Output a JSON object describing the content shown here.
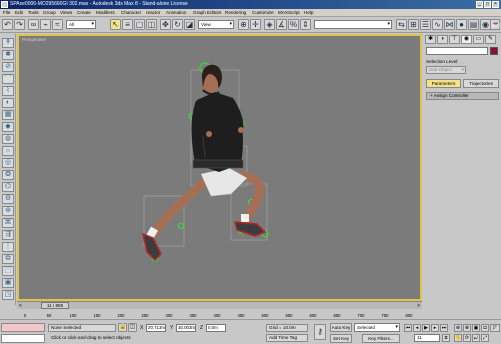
{
  "titlebar": {
    "title": "SPAxe0006-MO295660GI 302.max - Autodesk 3ds Max 8 - Stand-alone License",
    "min": "_",
    "max": "□",
    "close": "×"
  },
  "menu": [
    "File",
    "Edit",
    "Tools",
    "Group",
    "Views",
    "Create",
    "Modifiers",
    "Character",
    "reactor",
    "Animation",
    "Graph Editors",
    "Rendering",
    "Customize",
    "MAXScript",
    "Help"
  ],
  "toolbar": {
    "selection_filter": "All",
    "ref_coord": "View",
    "named_selection": "",
    "icons": [
      "undo-icon",
      "redo-icon",
      "link-icon",
      "unlink-icon",
      "bind-icon",
      "select-icon",
      "select-by-name-icon",
      "region-select-icon",
      "window-crossing-icon",
      "move-icon",
      "rotate-icon",
      "scale-icon",
      "pivot-icon",
      "manipulate-icon",
      "snap-icon",
      "angle-snap-icon",
      "percent-snap-icon",
      "spinner-snap-icon",
      "mirror-icon",
      "align-icon",
      "layer-icon",
      "curve-editor-icon",
      "schematic-icon",
      "material-editor-icon",
      "render-setup-icon",
      "render-icon",
      "quick-render-icon"
    ]
  },
  "viewport": {
    "label": "Perspective"
  },
  "command_panel": {
    "tab_icons": [
      "create-tab-icon",
      "modify-tab-icon",
      "hierarchy-tab-icon",
      "motion-tab-icon",
      "display-tab-icon",
      "utilities-tab-icon"
    ],
    "selection_level_label": "Selection Level:",
    "sub_object": "Sub-Object",
    "parameters_label": "Parameters",
    "trajectories_label": "Trajectories",
    "rollout_label": "Assign Controller",
    "colors": {
      "swatch": "#8a1038",
      "active_button": "#f2e38a"
    }
  },
  "time_slider": {
    "label": "11 / 895",
    "left": "<",
    "right": ">"
  },
  "trackbar": {
    "ticks": [
      "0",
      "50",
      "100",
      "150",
      "200",
      "250",
      "300",
      "350",
      "400",
      "450",
      "500",
      "550",
      "600",
      "650",
      "700",
      "750",
      "800"
    ]
  },
  "status": {
    "selected": "None Selected",
    "prompt": "Click or click-and-drag to select objects",
    "x_label": "X",
    "x_value": "20.713m",
    "y_label": "Y",
    "y_value": "30.003m",
    "z_label": "Z",
    "z_value": "0.0m",
    "grid": "Grid = 10.0m",
    "add_time_tag": "Add Time Tag",
    "auto_key": "Auto Key",
    "set_key": "Set Key",
    "key_mode": "Selected",
    "key_filters": "Key Filters...",
    "current_frame": "11"
  },
  "colors": {
    "viewport_bg": "#7b7b7b",
    "viewport_border": "#e1c34b",
    "helper_green": "#38d838"
  }
}
